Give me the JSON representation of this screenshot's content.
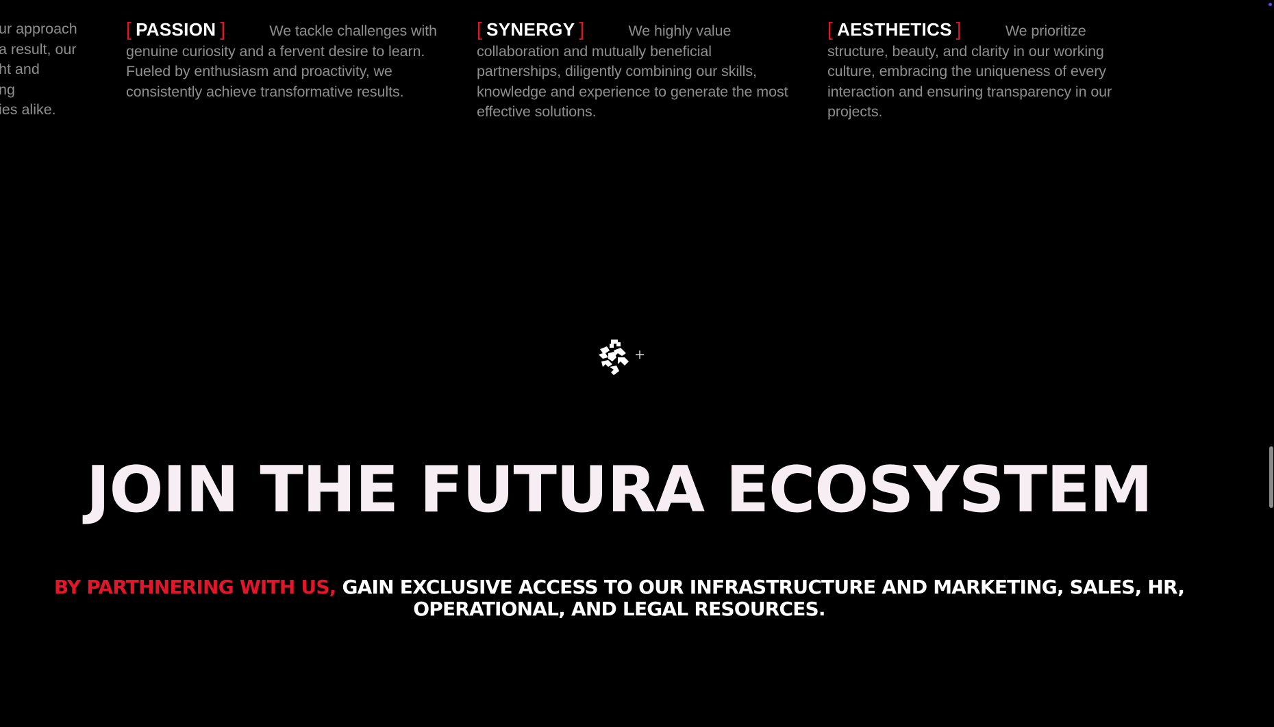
{
  "values": {
    "clipped": {
      "lines": [
        "ur approach",
        "a result, our",
        "ht and",
        "ng",
        "ies alike."
      ]
    },
    "cards": [
      {
        "heading": "PASSION",
        "lead": "We tackle challenges",
        "body": "with genuine curiosity and a fervent desire to learn. Fueled by enthusiasm and proactivity, we consistently achieve transformative results."
      },
      {
        "heading": "SYNERGY",
        "lead": "We highly value",
        "body": "collaboration and mutually beneficial partnerships, diligently combining our skills, knowledge and experience to generate the most effective solutions."
      },
      {
        "heading": "AESTHETICS",
        "lead": "We prioritize",
        "body": "structure, beauty, and clarity in our working culture, embracing the uniqueness of every interaction and ensuring transparency in our projects."
      }
    ],
    "bracket_open": "[",
    "bracket_close": "]"
  },
  "hero": {
    "title": "JOIN THE FUTURA ECOSYSTEM"
  },
  "tagline": {
    "accent": "BY PARTHNERING WITH US,",
    "rest": "GAIN EXCLUSIVE ACCESS TO OUR INFRASTRUCTURE AND MARKETING, SALES, HR, OPERATIONAL, AND LEGAL RESOURCES."
  },
  "icons": {
    "logo": "futura-logo-icon",
    "plus": "plus-icon"
  },
  "colors": {
    "background": "#000000",
    "accent": "#e1162b",
    "body_text": "#8e8e8e",
    "heading_text": "#ffffff",
    "hero_text": "#f6eef2"
  }
}
